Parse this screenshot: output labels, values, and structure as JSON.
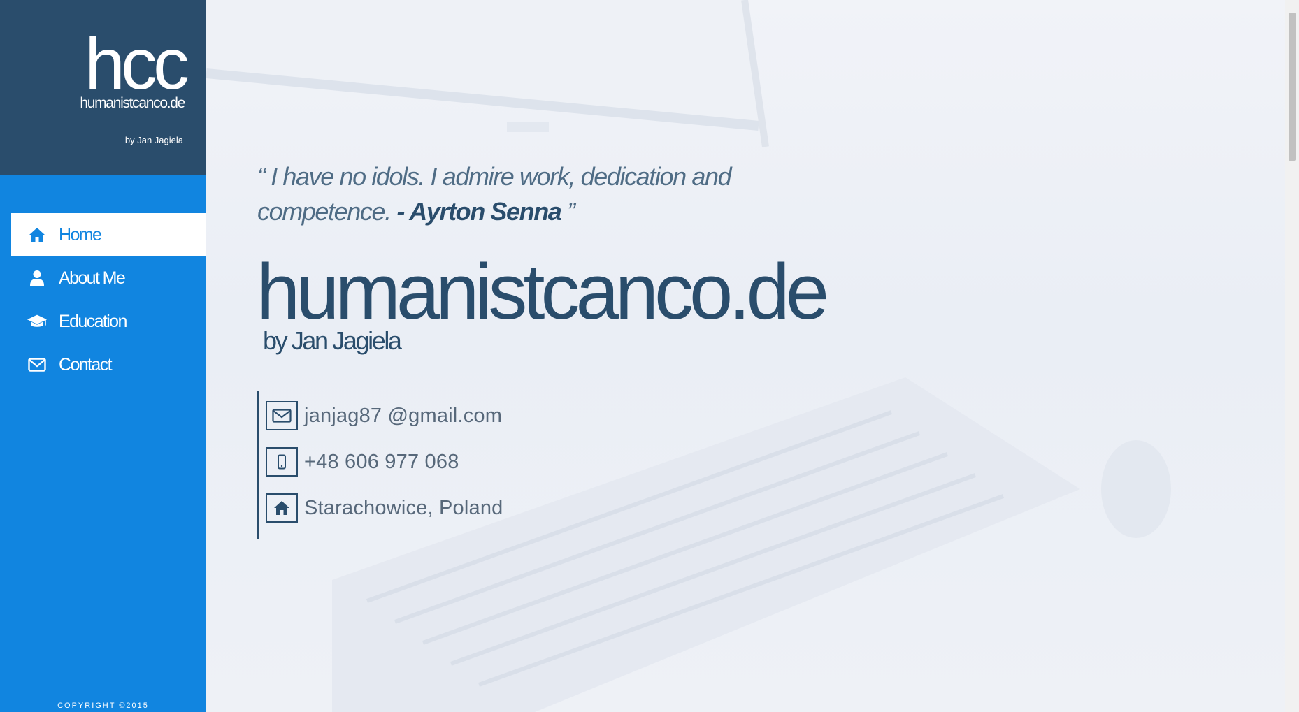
{
  "sidebar": {
    "logo": "hcc",
    "domain": "humanistcanco.de",
    "byline": "by Jan Jagiela",
    "nav": [
      {
        "label": "Home",
        "icon": "home-icon",
        "active": true
      },
      {
        "label": "About Me",
        "icon": "user-icon",
        "active": false
      },
      {
        "label": "Education",
        "icon": "graduation-cap-icon",
        "active": false
      },
      {
        "label": "Contact",
        "icon": "envelope-icon",
        "active": false
      }
    ],
    "copyright": "COPYRIGHT ©2015"
  },
  "main": {
    "quote": {
      "open": "“",
      "text": "I have no idols. I admire work, dedication and competence.",
      "author": "- Ayrton Senna",
      "close": "”"
    },
    "title": "humanistcanco.de",
    "subtitle": "by Jan Jagiela",
    "contacts": [
      {
        "icon": "envelope-icon",
        "text": "janjag87 @gmail.com"
      },
      {
        "icon": "mobile-phone-icon",
        "text": "+48 606 977 068"
      },
      {
        "icon": "home-icon",
        "text": "Starachowice, Poland"
      }
    ]
  },
  "colors": {
    "sidebar": "#1185e0",
    "brand": "#2a4d6c",
    "accent": "#2a4d6c"
  }
}
